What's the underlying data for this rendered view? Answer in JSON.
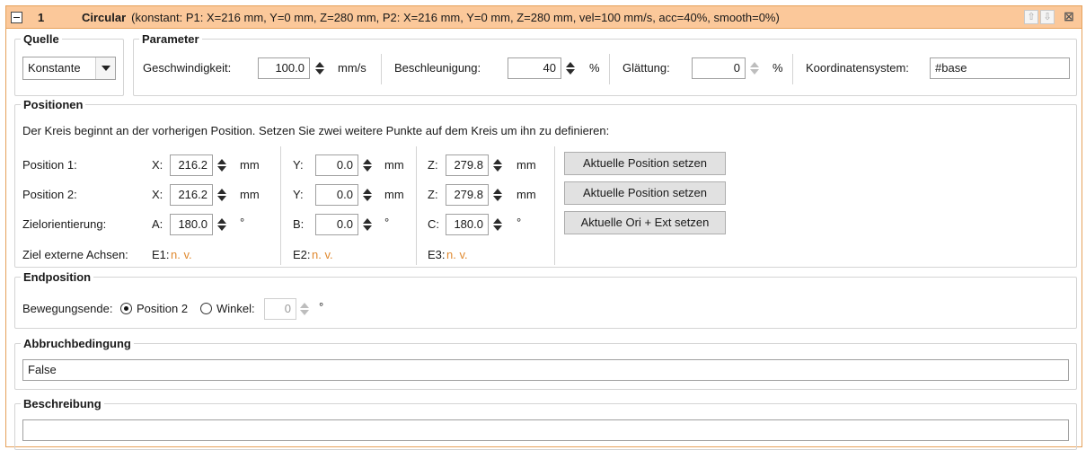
{
  "header": {
    "index": "1",
    "title": "Circular",
    "summary": "(konstant: P1: X=216 mm, Y=0 mm, Z=280 mm, P2: X=216 mm, Y=0 mm, Z=280 mm, vel=100 mm/s, acc=40%, smooth=0%)",
    "up_icon": "⇧",
    "down_icon": "⇩",
    "close_icon": "⊠"
  },
  "quelle": {
    "title": "Quelle",
    "selected": "Konstante"
  },
  "parameter": {
    "title": "Parameter",
    "speed_label": "Geschwindigkeit:",
    "speed_value": "100.0",
    "speed_unit": "mm/s",
    "accel_label": "Beschleunigung:",
    "accel_value": "40",
    "accel_unit": "%",
    "smooth_label": "Glättung:",
    "smooth_value": "0",
    "smooth_unit": "%",
    "coord_label": "Koordinatensystem:",
    "coord_value": "#base"
  },
  "positionen": {
    "title": "Positionen",
    "description": "Der Kreis beginnt an der vorherigen Position. Setzen Sie zwei weitere Punkte auf dem Kreis um ihn zu definieren:",
    "rows": [
      {
        "label": "Position 1:",
        "a": "X:",
        "a_val": "216.2",
        "a_unit": "mm",
        "b": "Y:",
        "b_val": "0.0",
        "b_unit": "mm",
        "c": "Z:",
        "c_val": "279.8",
        "c_unit": "mm",
        "button": "Aktuelle Position setzen"
      },
      {
        "label": "Position 2:",
        "a": "X:",
        "a_val": "216.2",
        "a_unit": "mm",
        "b": "Y:",
        "b_val": "0.0",
        "b_unit": "mm",
        "c": "Z:",
        "c_val": "279.8",
        "c_unit": "mm",
        "button": "Aktuelle Position setzen"
      },
      {
        "label": "Zielorientierung:",
        "a": "A:",
        "a_val": "180.0",
        "a_unit": "°",
        "b": "B:",
        "b_val": "0.0",
        "b_unit": "°",
        "c": "C:",
        "c_val": "180.0",
        "c_unit": "°",
        "button": "Aktuelle Ori + Ext setzen"
      }
    ],
    "ext_label": "Ziel externe Achsen:",
    "e1": "E1:",
    "e2": "E2:",
    "e3": "E3:",
    "na": "n. v."
  },
  "endposition": {
    "title": "Endposition",
    "label": "Bewegungsende:",
    "option1": "Position 2",
    "option2": "Winkel:",
    "angle_value": "0",
    "angle_unit": "°"
  },
  "abbruch": {
    "title": "Abbruchbedingung",
    "value": "False"
  },
  "beschreibung": {
    "title": "Beschreibung",
    "value": ""
  }
}
